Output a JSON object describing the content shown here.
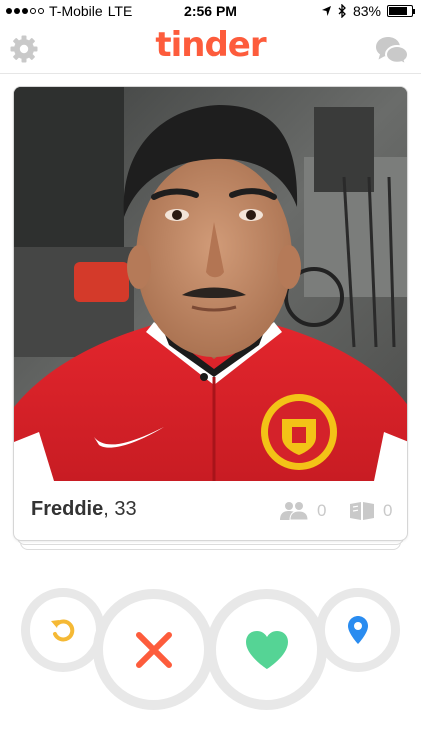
{
  "status_bar": {
    "carrier": "T-Mobile",
    "network": "LTE",
    "time": "2:56 PM",
    "battery": "83%",
    "battery_level": 0.83,
    "signal_bars_filled": 3,
    "signal_bars_total": 5
  },
  "header": {
    "logo_text": "tinder",
    "settings_icon": "gear-icon",
    "chat_icon": "chat-bubbles-icon",
    "brand_color": "#fd5c3c",
    "icon_color": "#c9c9c9"
  },
  "profile": {
    "name": "Freddie",
    "age_text": ", 33",
    "shared_friends": "0",
    "shared_interests": "0",
    "shared_friends_icon": "people-icon",
    "shared_interests_icon": "book-icon"
  },
  "actions": {
    "undo": {
      "icon": "undo-icon",
      "color": "#f5b935"
    },
    "nope": {
      "icon": "close-icon",
      "color": "#fd5c3c"
    },
    "like": {
      "icon": "heart-icon",
      "color": "#55d495"
    },
    "location": {
      "icon": "location-pin-icon",
      "color": "#2a8cf0"
    }
  }
}
